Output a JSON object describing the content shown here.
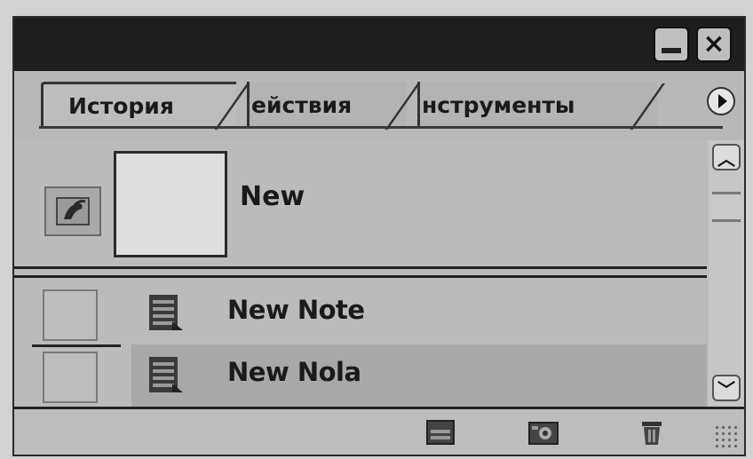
{
  "window": {
    "minimize_icon": "minimize-icon",
    "close_icon": "close-icon"
  },
  "tabs": [
    {
      "label": "История",
      "active": true
    },
    {
      "label": "ействия",
      "active": false
    },
    {
      "label": "нструменты",
      "active": false
    }
  ],
  "snapshot": {
    "label": "New",
    "source_icon": "history-brush-icon"
  },
  "steps": [
    {
      "label": "New Note",
      "icon": "note-icon"
    },
    {
      "label": "New Nola",
      "icon": "note-icon"
    }
  ],
  "footer": {
    "buttons": [
      "new-document-icon",
      "camera-snapshot-icon",
      "trash-icon"
    ]
  },
  "colors": {
    "titlebar": "#1e1e1e",
    "panel": "#bdbdbd"
  }
}
